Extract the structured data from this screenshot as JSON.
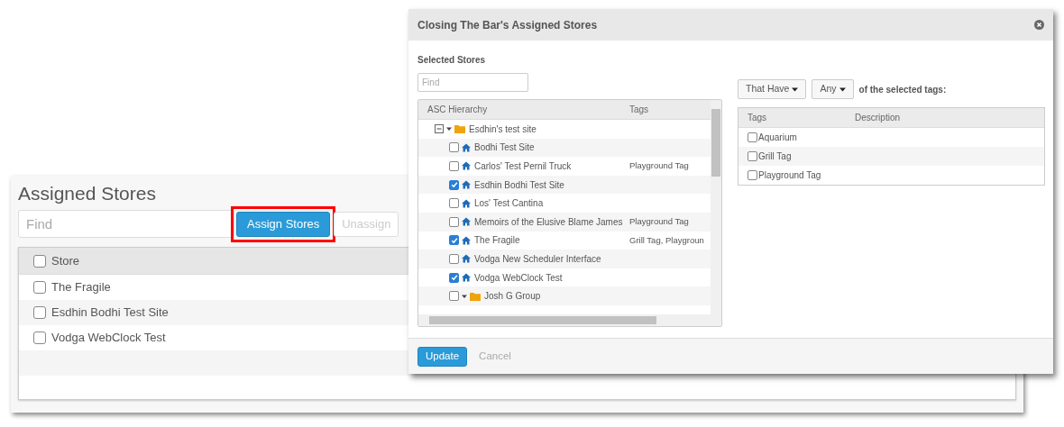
{
  "background_page": {
    "title": "Assigned Stores",
    "search": {
      "placeholder": "Find"
    },
    "buttons": [
      {
        "label": "Assign Stores",
        "kind": "primary",
        "highlighted": true,
        "disabled": false
      },
      {
        "label": "Unassign",
        "kind": "default",
        "highlighted": false,
        "disabled": true
      }
    ],
    "table": {
      "columns": [
        "Store"
      ],
      "header_checked": false,
      "rows": [
        {
          "store": "The Fragile",
          "checked": false
        },
        {
          "store": "Esdhin Bodhi Test Site",
          "checked": false
        },
        {
          "store": "Vodga WebClock Test",
          "checked": false
        }
      ]
    }
  },
  "dialog": {
    "title": "Closing The Bar's Assigned Stores",
    "section_label": "Selected Stores",
    "search": {
      "placeholder": "Find"
    },
    "tree": {
      "columns": [
        "ASC Hierarchy",
        "Tags"
      ],
      "items": [
        {
          "kind": "group",
          "label": "Esdhin's test site",
          "expanded": true,
          "children": [
            {
              "kind": "store",
              "label": "Bodhi Test Site",
              "checked": false
            },
            {
              "kind": "store",
              "label": "Carlos' Test Pernil Truck",
              "checked": false,
              "tags": "Playground Tag"
            },
            {
              "kind": "store",
              "label": "Esdhin Bodhi Test Site",
              "checked": true
            },
            {
              "kind": "store",
              "label": "Los' Test Cantina",
              "checked": false
            },
            {
              "kind": "store",
              "label": "Memoirs of the Elusive Blame James",
              "checked": false,
              "tags": "Playground Tag"
            },
            {
              "kind": "store",
              "label": "The Fragile",
              "checked": true,
              "tags": "Grill Tag, Playgroun"
            },
            {
              "kind": "store",
              "label": "Vodga New Scheduler Interface",
              "checked": false
            },
            {
              "kind": "store",
              "label": "Vodga WebClock Test",
              "checked": true
            },
            {
              "kind": "folder",
              "label": "Josh G Group",
              "checked": false,
              "expanded": true
            }
          ]
        }
      ]
    },
    "filter": {
      "buttons": [
        "That Have",
        "Any"
      ],
      "text": "of the selected tags:"
    },
    "tags_table": {
      "columns": [
        "Tags",
        "Description"
      ],
      "rows": [
        {
          "tag": "Aquarium",
          "checked": false
        },
        {
          "tag": "Grill Tag",
          "checked": false
        },
        {
          "tag": "Playground Tag",
          "checked": false
        }
      ]
    },
    "buttons": [
      {
        "label": "Update",
        "kind": "primary"
      },
      {
        "label": "Cancel",
        "kind": "link"
      }
    ]
  }
}
